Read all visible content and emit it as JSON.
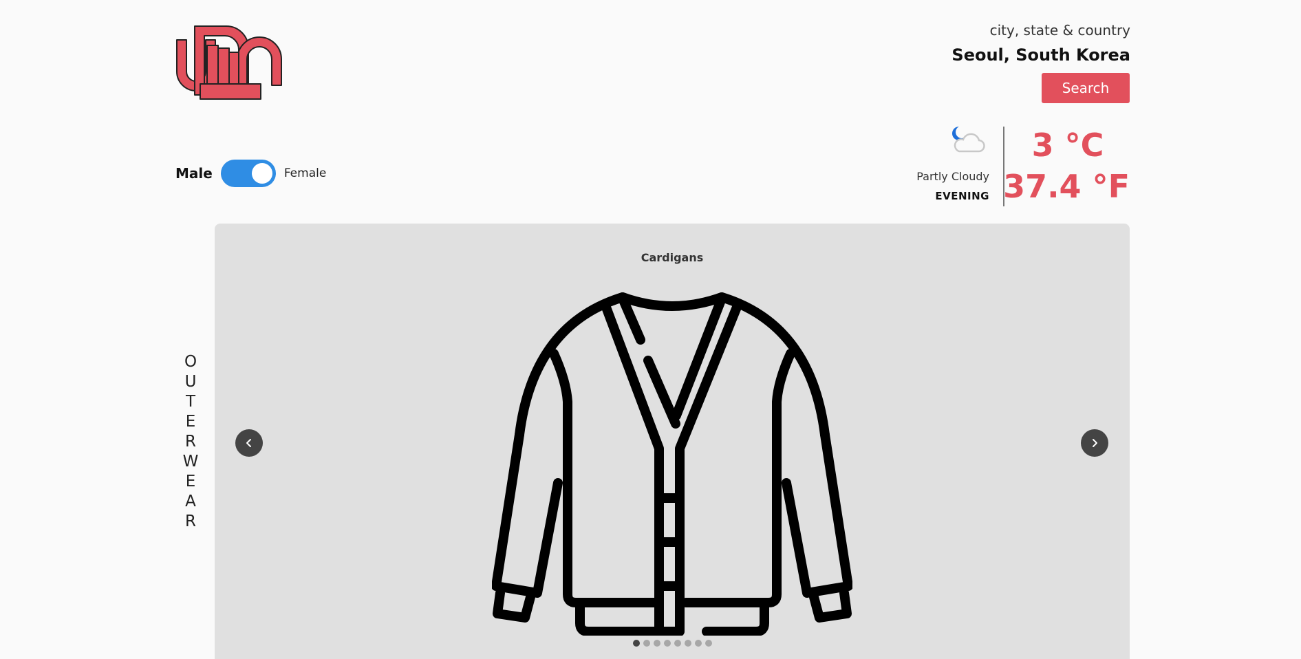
{
  "brand": {
    "logo_icon": "brand-logo",
    "accent_color": "#e2505c"
  },
  "location": {
    "label": "city, state & country",
    "value": "Seoul, South Korea",
    "search_label": "Search"
  },
  "gender": {
    "male_label": "Male",
    "female_label": "Female",
    "selected": "Female",
    "toggle_color": "#2f8de4"
  },
  "weather": {
    "icon": "partly-cloudy-night-icon",
    "condition": "Partly Cloudy",
    "period": "EVENING",
    "temp_c": "3 °C",
    "temp_f": "37.4 °F"
  },
  "category": {
    "name": "OUTERWEAR",
    "letters": [
      "O",
      "U",
      "T",
      "E",
      "R",
      "W",
      "E",
      "A",
      "R"
    ]
  },
  "carousel": {
    "item_title": "Cardigans",
    "item_icon": "cardigan-icon",
    "prev_icon": "chevron-left-icon",
    "next_icon": "chevron-right-icon",
    "slide_count": 8,
    "active_index": 0
  }
}
